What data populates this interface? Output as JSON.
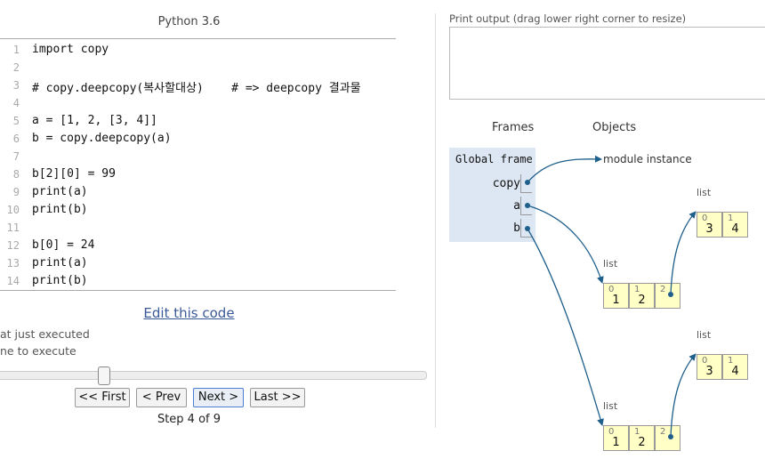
{
  "editor": {
    "title": "Python 3.6",
    "lines": [
      {
        "num": "1",
        "text": "import copy"
      },
      {
        "num": "2",
        "text": ""
      },
      {
        "num": "3",
        "text": "# copy.deepcopy(복사할대상)    # => deepcopy 결과물"
      },
      {
        "num": "4",
        "text": ""
      },
      {
        "num": "5",
        "text": "a = [1, 2, [3, 4]]"
      },
      {
        "num": "6",
        "text": "b = copy.deepcopy(a)"
      },
      {
        "num": "7",
        "text": ""
      },
      {
        "num": "8",
        "text": "b[2][0] = 99"
      },
      {
        "num": "9",
        "text": "print(a)"
      },
      {
        "num": "10",
        "text": "print(b)"
      },
      {
        "num": "11",
        "text": ""
      },
      {
        "num": "12",
        "text": "b[0] = 24"
      },
      {
        "num": "13",
        "text": "print(a)"
      },
      {
        "num": "14",
        "text": "print(b)"
      }
    ],
    "edit_link": "Edit this code",
    "legend_executed": "at just executed",
    "legend_next": "ne to execute"
  },
  "controls": {
    "first": "<< First",
    "prev": "< Prev",
    "next": "Next >",
    "last": "Last >>",
    "step": "Step 4 of 9",
    "current_step": 4,
    "total_steps": 9
  },
  "output": {
    "label": "Print output (drag lower right corner to resize)",
    "text": ""
  },
  "viz": {
    "frames_header": "Frames",
    "objects_header": "Objects",
    "global_frame": "Global frame",
    "variables": [
      "copy",
      "a",
      "b"
    ],
    "module_label": "module instance",
    "list_label": "list",
    "list_a": {
      "indices": [
        "0",
        "1",
        "2"
      ],
      "values": [
        "1",
        "2",
        ""
      ]
    },
    "list_a_inner": {
      "indices": [
        "0",
        "1"
      ],
      "values": [
        "3",
        "4"
      ]
    },
    "list_b": {
      "indices": [
        "0",
        "1",
        "2"
      ],
      "values": [
        "1",
        "2",
        ""
      ]
    },
    "list_b_inner": {
      "indices": [
        "0",
        "1"
      ],
      "values": [
        "3",
        "4"
      ]
    },
    "arrow_color": "#1f5f8b",
    "frame_color": "#dde6f3",
    "heap_color": "#ffffc6"
  }
}
